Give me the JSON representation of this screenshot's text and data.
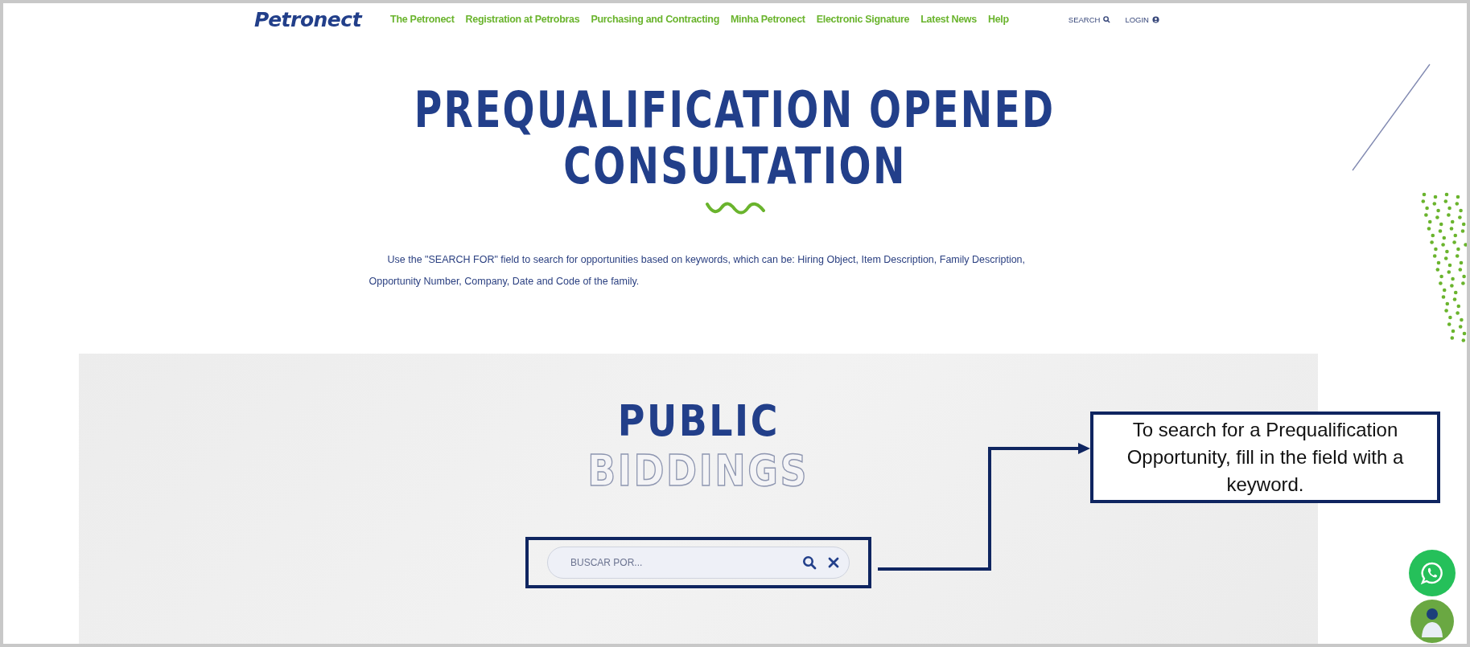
{
  "header": {
    "logo": "Petronect",
    "nav": [
      {
        "label": "The Petronect"
      },
      {
        "label": "Registration at Petrobras"
      },
      {
        "label": "Purchasing and Contracting"
      },
      {
        "label": "Minha Petronect"
      },
      {
        "label": "Electronic Signature"
      },
      {
        "label": "Latest News"
      },
      {
        "label": "Help"
      }
    ],
    "utilities": [
      {
        "label": "SEARCH",
        "kind": "search"
      },
      {
        "label": "LOGIN",
        "kind": "login"
      }
    ]
  },
  "hero": {
    "title_lines": [
      "PREQUALIFICATION OPENED",
      "CONSULTATION"
    ],
    "description": "Use the \"SEARCH FOR\" field to search for opportunities based on keywords, which can be: Hiring Object, Item Description, Family Description, Opportunity Number, Company, Date and Code of the family."
  },
  "biddings": {
    "title": "PUBLIC",
    "subtitle": "BIDDINGS",
    "search": {
      "placeholder": "BUSCAR POR..."
    }
  },
  "callout": {
    "text": "To search for a Prequalification Opportunity, fill in the field with a keyword."
  }
}
